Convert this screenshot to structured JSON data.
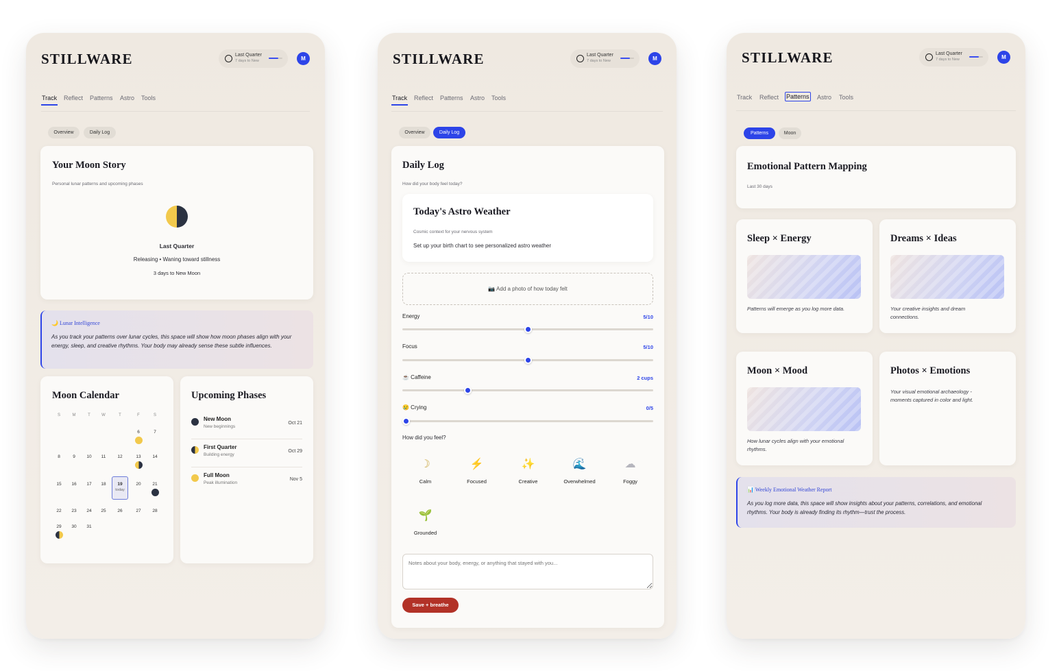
{
  "app": {
    "logo": "STILLWARE",
    "moon_pill": {
      "phase": "Last Quarter",
      "sub": "7 days to New",
      "progress": 0.7
    },
    "avatar": "M",
    "nav": [
      "Track",
      "Reflect",
      "Patterns",
      "Astro",
      "Tools"
    ],
    "accent": "#2d44e8"
  },
  "screen1": {
    "subtabs": [
      "Overview",
      "Daily Log"
    ],
    "moon_story": {
      "title": "Your Moon Story",
      "subtitle": "Personal lunar patterns and upcoming phases",
      "phase": "Last Quarter",
      "desc": "Releasing • Waning toward stillness",
      "countdown": "3 days to New Moon"
    },
    "lunar": {
      "title": "🌙 Lunar Intelligence",
      "body": "As you track your patterns over lunar cycles, this space will show how moon phases align with your energy, sleep, and creative rhythms. Your body may already sense these subtle influences."
    },
    "calendar": {
      "title": "Moon Calendar",
      "weekdays": [
        "S",
        "M",
        "T",
        "W",
        "T",
        "F",
        "S"
      ],
      "rows": [
        [
          "",
          "",
          "",
          "",
          "",
          "6",
          "7"
        ],
        [
          "8",
          "9",
          "10",
          "11",
          "12",
          "13",
          "14"
        ],
        [
          "15",
          "16",
          "17",
          "18",
          "19",
          "20",
          "21"
        ],
        [
          "22",
          "23",
          "24",
          "25",
          "26",
          "27",
          "28"
        ],
        [
          "29",
          "30",
          "31",
          "",
          "",
          "",
          ""
        ]
      ],
      "today_label": "today"
    },
    "phases": {
      "title": "Upcoming Phases",
      "items": [
        {
          "name": "New Moon",
          "sub": "New beginnings",
          "date": "Oct 21"
        },
        {
          "name": "First Quarter",
          "sub": "Building energy",
          "date": "Oct 29"
        },
        {
          "name": "Full Moon",
          "sub": "Peak illumination",
          "date": "Nov 5"
        }
      ]
    }
  },
  "screen2": {
    "subtabs": [
      "Overview",
      "Daily Log"
    ],
    "title": "Daily Log",
    "question": "How did your body feel today?",
    "astro": {
      "title": "Today's Astro Weather",
      "sub": "Cosmic context for your nervous system",
      "body": "Set up your birth chart to see personalized astro weather"
    },
    "photo": "📷 Add a photo of how today felt",
    "sliders": [
      {
        "label": "Energy",
        "value": "5/10",
        "level": 0.5
      },
      {
        "label": "Focus",
        "value": "5/10",
        "level": 0.5
      },
      {
        "label": "☕ Caffeine",
        "value": "2 cups",
        "level": 0.26
      },
      {
        "label": "😢 Crying",
        "value": "0/5",
        "level": 0.0
      }
    ],
    "feel_q": "How did you feel?",
    "moods": [
      {
        "icon": "☽",
        "label": "Calm"
      },
      {
        "icon": "⚡",
        "label": "Focused"
      },
      {
        "icon": "✨",
        "label": "Creative"
      },
      {
        "icon": "🌊",
        "label": "Overwhelmed"
      },
      {
        "icon": "☁",
        "label": "Foggy"
      },
      {
        "icon": "🌱",
        "label": "Grounded"
      }
    ],
    "notes_placeholder": "Notes about your body, energy, or anything that stayed with you...",
    "save": "Save + breathe",
    "save_color": "#b23227"
  },
  "screen3": {
    "subtabs": [
      "Patterns",
      "Moon"
    ],
    "title": "Emotional Pattern Mapping",
    "range": "Last 30 days",
    "cards": [
      {
        "title": "Sleep × Energy",
        "text": "Patterns will emerge as you log more data."
      },
      {
        "title": "Dreams × Ideas",
        "text": "Your creative insights and dream connections."
      },
      {
        "title": "Moon × Mood",
        "text": "How lunar cycles align with your emotional rhythms."
      },
      {
        "title": "Photos × Emotions",
        "text": "Your visual emotional archaeology - moments captured in color and light."
      }
    ],
    "report": {
      "title": "📊 Weekly Emotional Weather Report",
      "body": "As you log more data, this space will show insights about your patterns, correlations, and emotional rhythms. Your body is already finding its rhythm—trust the process."
    }
  }
}
